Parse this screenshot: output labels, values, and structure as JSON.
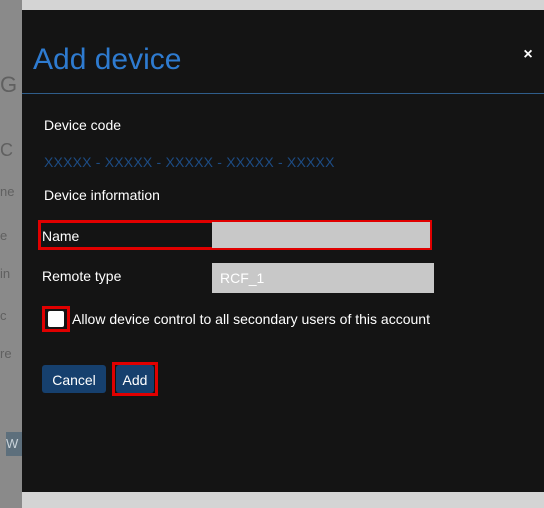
{
  "dialog": {
    "title": "Add device",
    "close_glyph": "×",
    "device_code_label": "Device code",
    "device_code_value": "XXXXX - XXXXX - XXXXX - XXXXX - XXXXX",
    "device_info_label": "Device information",
    "name_label": "Name",
    "name_value": "",
    "remote_type_label": "Remote type",
    "remote_type_value": "RCF_1",
    "checkbox_label": "Allow device control to all secondary users of this account",
    "checkbox_checked": false,
    "cancel_label": "Cancel",
    "add_label": "Add"
  },
  "background": {
    "letters": [
      "G",
      "C",
      "ne",
      "e",
      "in",
      "c",
      "re"
    ],
    "block_letter": "W"
  },
  "colors": {
    "modal_bg": "#141414",
    "title": "#2e7bd0",
    "device_code": "#1d4c84",
    "highlight": "#e00000",
    "button_bg": "#16406e",
    "input_bg": "#c8c8c8"
  }
}
